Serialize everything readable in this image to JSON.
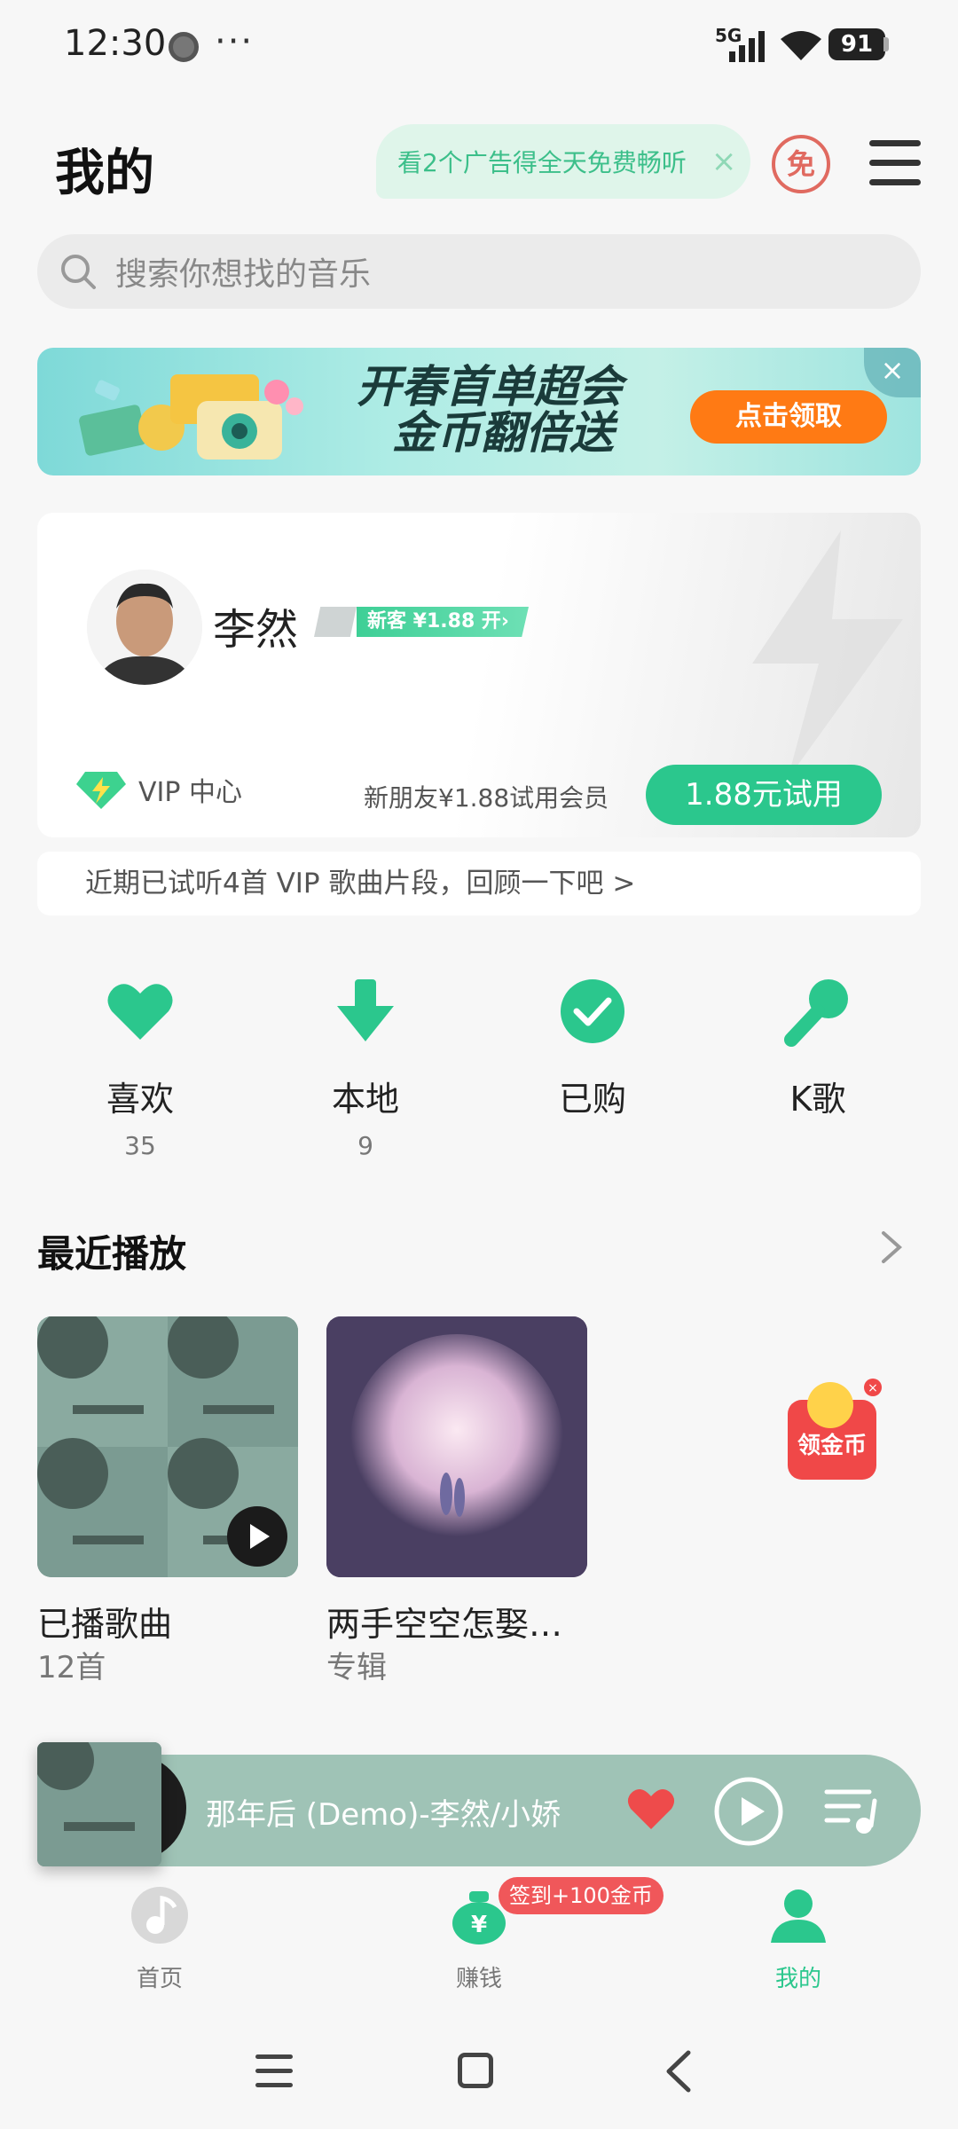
{
  "status": {
    "time": "12:30",
    "dots": "···",
    "network": "5G",
    "battery": "91"
  },
  "header": {
    "title": "我的",
    "ad_text": "看2个广告得全天免费畅听",
    "ad_close": "×",
    "free_badge": "免"
  },
  "search": {
    "placeholder": "搜索你想找的音乐"
  },
  "banner": {
    "line1": "开春首单超会",
    "line2": "金币翻倍送",
    "button": "点击领取",
    "close": "×"
  },
  "profile": {
    "name": "李然",
    "vip_tag": "新客 ¥1.88 开›",
    "vip_center": "VIP 中心",
    "trial_text": "新朋友¥1.88试用会员",
    "trial_button": "1.88元试用"
  },
  "recent_vip": "近期已试听4首 VIP 歌曲片段，回顾一下吧 >",
  "quick_actions": [
    {
      "label": "喜欢",
      "count": "35",
      "icon": "heart-icon"
    },
    {
      "label": "本地",
      "count": "9",
      "icon": "download-icon"
    },
    {
      "label": "已购",
      "count": "",
      "icon": "check-icon"
    },
    {
      "label": "K歌",
      "count": "",
      "icon": "microphone-icon"
    }
  ],
  "recent": {
    "title": "最近播放",
    "items": [
      {
        "title": "已播歌曲",
        "sub": "12首"
      },
      {
        "title": "两手空空怎娶…",
        "sub": "专辑"
      }
    ],
    "coin_float": "领金币"
  },
  "player": {
    "title": "那年后 (Demo)-李然/小娇"
  },
  "tabs": [
    {
      "label": "首页",
      "icon": "music-note-icon"
    },
    {
      "label": "赚钱",
      "icon": "money-bag-icon"
    },
    {
      "label": "我的",
      "icon": "user-icon"
    }
  ],
  "signin_badge": "签到+100金币",
  "colors": {
    "accent": "#2bc78d",
    "banner_button": "#ff7a14",
    "badge": "#f0575a"
  }
}
